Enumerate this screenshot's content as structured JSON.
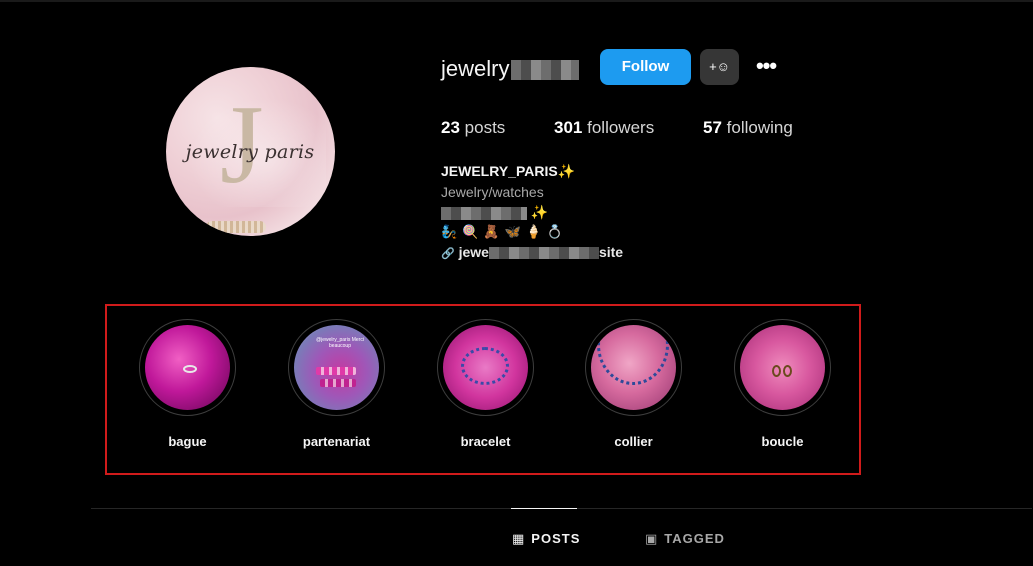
{
  "profile": {
    "username": "jewelry",
    "follow_label": "Follow",
    "add_user_label": "+☺",
    "more_label": "•••",
    "avatar_letter": "J",
    "avatar_text": "jewelry paris",
    "stats": {
      "posts_count": "23",
      "posts_label": "posts",
      "followers_count": "301",
      "followers_label": "followers",
      "following_count": "57",
      "following_label": "following"
    },
    "bio": {
      "name": "JEWELRY_PARIS✨",
      "category": "Jewelry/watches",
      "line3_suffix": "✨",
      "emojis": "🧞🍭🧸🦋🍦💍",
      "link_prefix": "jewe",
      "link_suffix": "site",
      "link_icon": "🔗"
    }
  },
  "highlights": [
    {
      "label": "bague"
    },
    {
      "label": "partenariat"
    },
    {
      "label": "bracelet"
    },
    {
      "label": "collier"
    },
    {
      "label": "boucle"
    }
  ],
  "highlight_thumb_text": {
    "partenariat": "@jewelry_paris Merci beaucoup"
  },
  "tabs": {
    "posts_label": "POSTS",
    "posts_icon": "▦",
    "tagged_label": "TAGGED",
    "tagged_icon": "▣"
  },
  "colors": {
    "follow_button": "#1d9bf0",
    "highlight_box_border": "#d01b1b",
    "background": "#000000"
  }
}
